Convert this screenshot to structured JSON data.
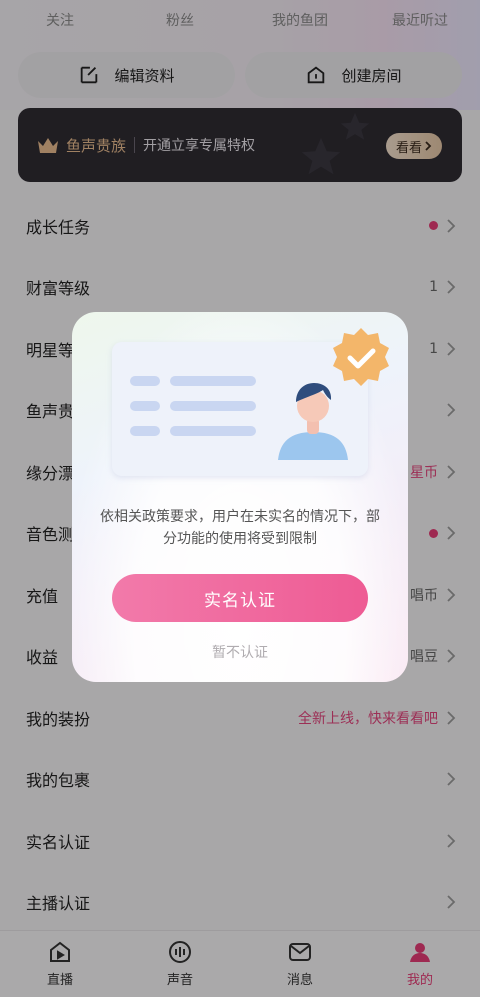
{
  "top_tabs": [
    "关注",
    "粉丝",
    "我的鱼团",
    "最近听过"
  ],
  "quick_actions": [
    {
      "label": "编辑资料",
      "icon": "edit-icon"
    },
    {
      "label": "创建房间",
      "icon": "home-icon"
    }
  ],
  "vip_banner": {
    "title": "鱼声贵族",
    "subtitle": "开通立享专属特权",
    "button": "看看",
    "colors": {
      "background": "#2e2b32",
      "title": "#e5b98d"
    }
  },
  "menu": [
    {
      "label": "成长任务",
      "value": "",
      "dot": true
    },
    {
      "label": "财富等级",
      "value": "1",
      "dot": false
    },
    {
      "label": "明星等",
      "value": "1",
      "dot": false
    },
    {
      "label": "鱼声贵",
      "value": "",
      "dot": false
    },
    {
      "label": "缘分漂",
      "value": "星币",
      "dot": false,
      "pink": true
    },
    {
      "label": "音色测",
      "value": "",
      "dot": true
    },
    {
      "label": "充值",
      "value": "唱币",
      "dot": false
    },
    {
      "label": "收益",
      "value": "唱豆",
      "dot": false
    },
    {
      "label": "我的装扮",
      "value": "全新上线，快来看看吧",
      "dot": false,
      "pink": true
    },
    {
      "label": "我的包裹",
      "value": "",
      "dot": false
    },
    {
      "label": "实名认证",
      "value": "",
      "dot": false
    },
    {
      "label": "主播认证",
      "value": "",
      "dot": false
    }
  ],
  "bottom_nav": [
    {
      "label": "直播",
      "icon": "live-icon",
      "active": false
    },
    {
      "label": "声音",
      "icon": "voice-icon",
      "active": false
    },
    {
      "label": "消息",
      "icon": "message-icon",
      "active": false
    },
    {
      "label": "我的",
      "icon": "profile-icon",
      "active": true
    }
  ],
  "modal": {
    "message": "依相关政策要求，用户在未实名的情况下，部分功能的使用将受到限制",
    "confirm_label": "实名认证",
    "skip_label": "暂不认证",
    "colors": {
      "primary": "#ee5b94",
      "badge": "#f3b66a"
    }
  }
}
